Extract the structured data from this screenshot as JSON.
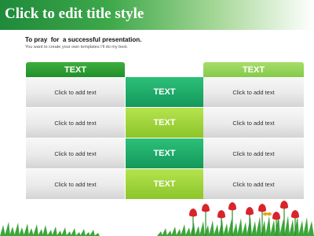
{
  "slide": {
    "title": "Click to edit title style",
    "subtitle": "To pray  for  a successful presentation.",
    "subnote": "You want to create your own templates I'll do my best."
  },
  "table": {
    "left_header": "TEXT",
    "right_header": "TEXT",
    "rows": [
      {
        "left": "Click to add text",
        "mid": "TEXT",
        "right": "Click to add text"
      },
      {
        "left": "Click to add text",
        "mid": "TEXT",
        "right": "Click to add text"
      },
      {
        "left": "Click to add text",
        "mid": "TEXT",
        "right": "Click to add text"
      },
      {
        "left": "Click to add text",
        "mid": "TEXT",
        "right": "Click to add text"
      }
    ]
  },
  "colors": {
    "title_green": "#1f8a3a",
    "dark_green": "#1f8f2a",
    "light_green": "#8cc52a",
    "teal_green": "#14985a"
  },
  "decoration": {
    "bottom": "grass-and-tulips-icon"
  }
}
